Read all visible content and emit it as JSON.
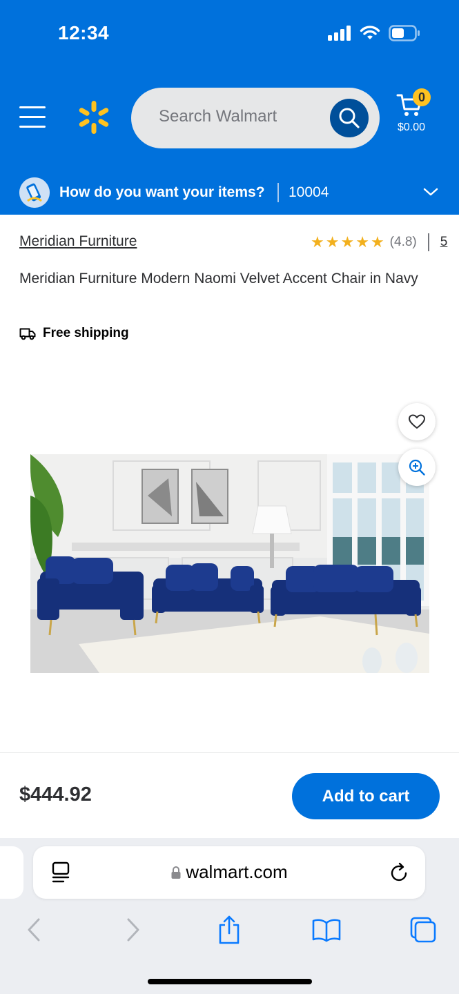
{
  "status": {
    "time": "12:34"
  },
  "header": {
    "search_placeholder": "Search Walmart",
    "cart": {
      "count": "0",
      "total": "$0.00"
    },
    "colors": {
      "brand_blue": "#0071dc",
      "spark_yellow": "#ffc220"
    }
  },
  "delivery": {
    "question": "How do you want your items?",
    "zip": "10004"
  },
  "product": {
    "brand": "Meridian Furniture",
    "rating": {
      "stars": 4.8,
      "value_text": "(4.8)",
      "review_count": "5"
    },
    "title": "Meridian Furniture Modern Naomi Velvet Accent Chair in Navy",
    "shipping": "Free shipping"
  },
  "purchase": {
    "price": "$444.92",
    "add_to_cart": "Add to cart"
  },
  "browser": {
    "url": "walmart.com"
  }
}
